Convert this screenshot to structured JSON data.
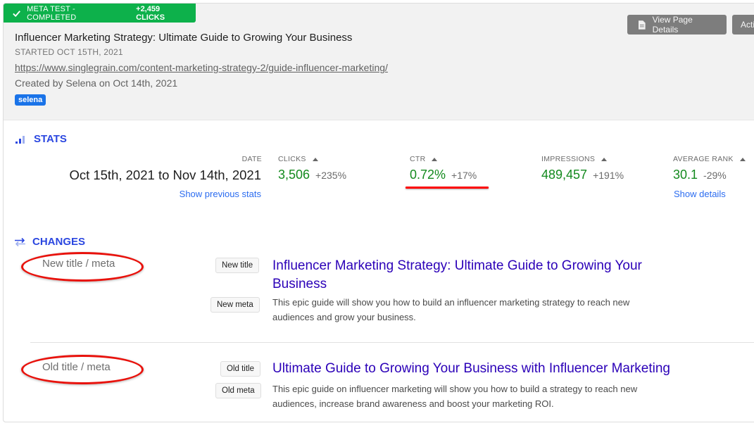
{
  "header": {
    "status_banner": {
      "icon": "check-icon",
      "status": "META TEST - COMPLETED",
      "clicks_gain": "+2,459 CLICKS",
      "color": "#0db14b"
    },
    "title": "Influencer Marketing Strategy: Ultimate Guide to Growing Your Business",
    "started": "STARTED OCT 15TH, 2021",
    "url": "https://www.singlegrain.com/content-marketing-strategy-2/guide-influencer-marketing/",
    "created_by": "Created by Selena on Oct 14th, 2021",
    "tag": "selena",
    "buttons": {
      "view_page_details": {
        "label": "View Page Details",
        "icon": "document-icon"
      },
      "actions": {
        "label": "Actions"
      }
    }
  },
  "stats": {
    "section_title": "STATS",
    "icon": "bar-chart-icon",
    "date": {
      "label": "DATE",
      "value": "Oct 15th, 2021 to Nov 14th, 2021",
      "link": "Show previous stats"
    },
    "metrics": [
      {
        "label": "CLICKS",
        "value": "3,506",
        "delta": "+235%",
        "sort_icon": "triangle-up-icon"
      },
      {
        "label": "CTR",
        "value": "0.72%",
        "delta": "+17%",
        "sort_icon": "triangle-up-icon",
        "highlighted": true
      },
      {
        "label": "IMPRESSIONS",
        "value": "489,457",
        "delta": "+191%",
        "sort_icon": "triangle-up-icon"
      },
      {
        "label": "AVERAGE RANK",
        "value": "30.1",
        "delta": "-29%",
        "sort_icon": "triangle-up-icon",
        "link": "Show details"
      }
    ],
    "value_color": "#138a1e",
    "link_color": "#2b6cf0"
  },
  "changes": {
    "section_title": "CHANGES",
    "icon": "swap-arrows-icon",
    "rows": [
      {
        "label": "New title / meta",
        "title_pill": "New title",
        "meta_pill": "New meta",
        "title": "Influencer Marketing Strategy: Ultimate Guide to Growing Your Business",
        "description": "This epic guide will show you how to build an influencer marketing strategy to reach new audiences and grow your business."
      },
      {
        "label": "Old title / meta",
        "title_pill": "Old title",
        "meta_pill": "Old meta",
        "title": "Ultimate Guide to Growing Your Business with Influencer Marketing",
        "description": "This epic guide on influencer marketing will show you how to build a strategy to reach new audiences, increase brand awareness and boost your marketing ROI."
      }
    ],
    "serp_title_color": "#2b00b8",
    "annotation_color": "#e8120c"
  }
}
